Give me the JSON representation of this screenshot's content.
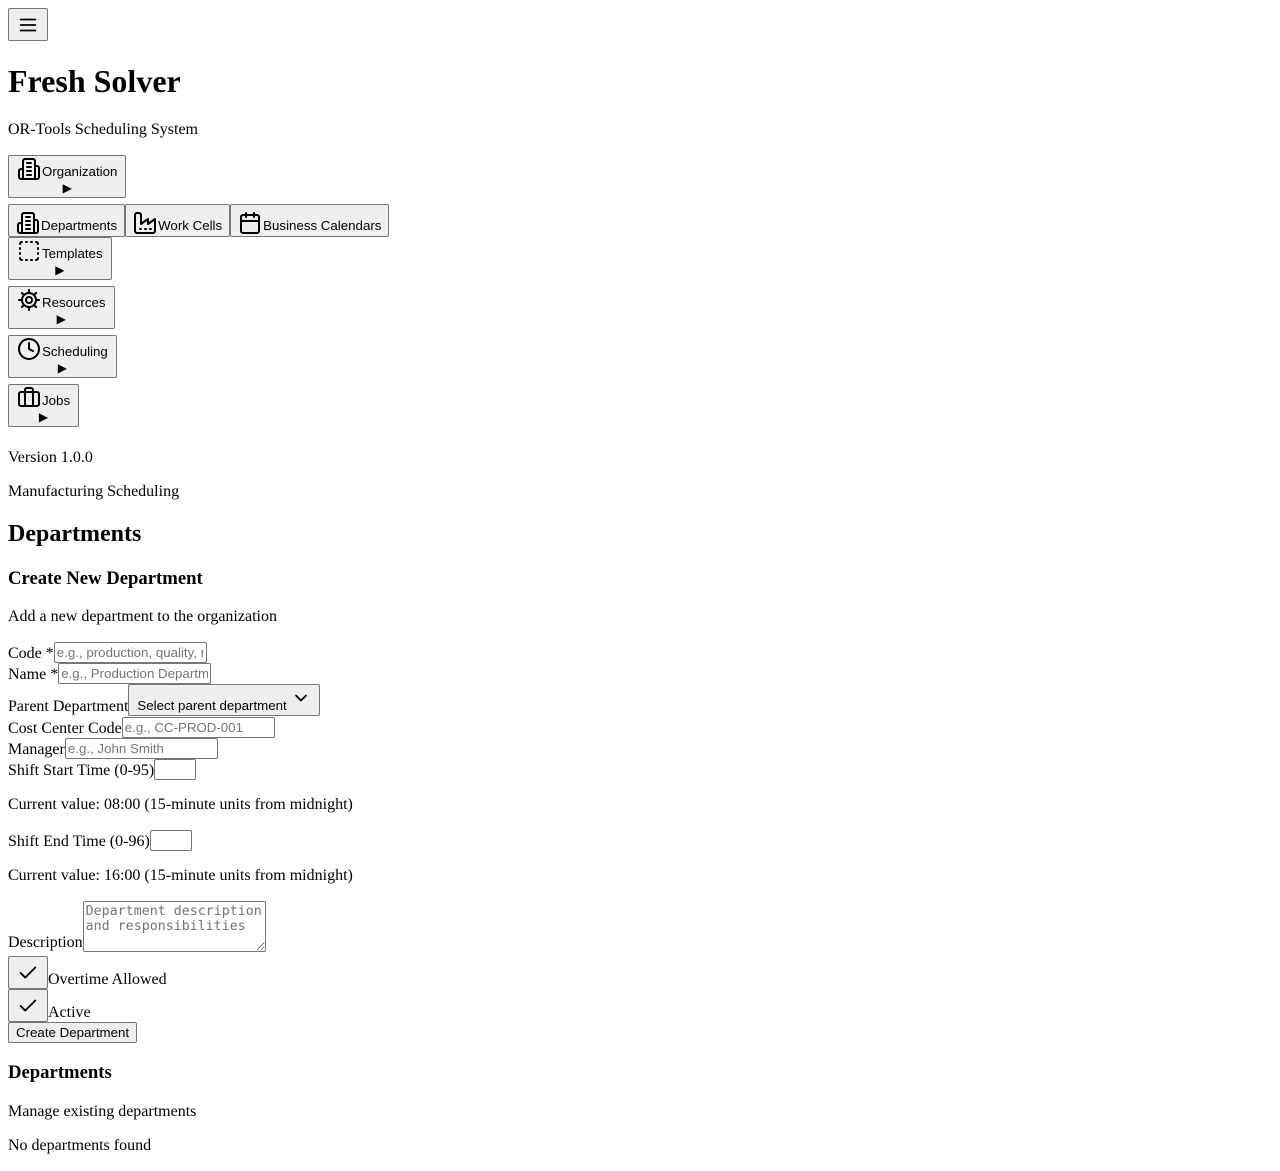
{
  "header": {
    "menu_icon": "menu-icon",
    "app_title": "Fresh Solver",
    "app_subtitle": "OR-Tools Scheduling System"
  },
  "nav": {
    "organization": {
      "label": "Organization",
      "icon": "building-icon",
      "arrow": "▶"
    },
    "sub_items": [
      {
        "label": "Departments",
        "icon": "building-icon"
      },
      {
        "label": "Work Cells",
        "icon": "factory-icon"
      },
      {
        "label": "Business Calendars",
        "icon": "calendar-icon"
      }
    ],
    "templates": {
      "label": "Templates",
      "icon": "dashed-square-icon",
      "arrow": "▶"
    },
    "resources": {
      "label": "Resources",
      "icon": "gear-icon",
      "arrow": "▶"
    },
    "scheduling": {
      "label": "Scheduling",
      "icon": "clock-icon",
      "arrow": "▶"
    },
    "jobs": {
      "label": "Jobs",
      "icon": "briefcase-icon",
      "arrow": "▶"
    }
  },
  "footer_info": {
    "version": "Version 1.0.0",
    "tagline": "Manufacturing Scheduling"
  },
  "page": {
    "title": "Departments"
  },
  "create_form": {
    "title": "Create New Department",
    "description": "Add a new department to the organization",
    "code_label": "Code *",
    "code_placeholder": "e.g., production, quality, maintenance",
    "name_label": "Name *",
    "name_placeholder": "e.g., Production Department",
    "parent_label": "Parent Department",
    "parent_select_value": "Select parent department",
    "cost_center_label": "Cost Center Code",
    "cost_center_placeholder": "e.g., CC-PROD-001",
    "manager_label": "Manager",
    "manager_placeholder": "e.g., John Smith",
    "shift_start_label": "Shift Start Time (0-95)",
    "shift_start_help": "Current value: 08:00 (15-minute units from midnight)",
    "shift_end_label": "Shift End Time (0-96)",
    "shift_end_help": "Current value: 16:00 (15-minute units from midnight)",
    "description_label": "Description",
    "description_placeholder": "Department description and responsibilities",
    "overtime_label": "Overtime Allowed",
    "overtime_checked": true,
    "active_label": "Active",
    "active_checked": true,
    "submit_label": "Create Department"
  },
  "list": {
    "title": "Departments",
    "description": "Manage existing departments",
    "empty_text": "No departments found"
  }
}
